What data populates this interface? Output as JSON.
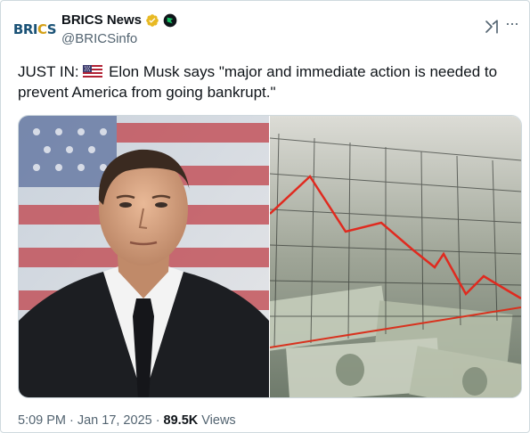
{
  "account": {
    "avatar_text_a": "BRI",
    "avatar_text_b": "C",
    "avatar_text_c": "S",
    "display_name": "BRICS News",
    "handle": "@BRICSinfo",
    "verified_color": "#e8b923",
    "affiliate_badge_color": "#17bf63"
  },
  "icons": {
    "grok": "grok-icon",
    "more": "more-icon",
    "verified": "verified-badge-icon",
    "flag": "us-flag-icon"
  },
  "tweet": {
    "prefix": "JUST IN:",
    "body": " Elon Musk says \"major and immediate action is needed to prevent America from going bankrupt.\""
  },
  "media": {
    "left_image": "portrait-photo",
    "right_image": "declining-chart-over-dollars"
  },
  "footer": {
    "time": "5:09 PM",
    "sep1": "·",
    "date": "Jan 17, 2025",
    "sep2": "·",
    "views_count": "89.5K",
    "views_label": "Views"
  },
  "more_label": "···"
}
